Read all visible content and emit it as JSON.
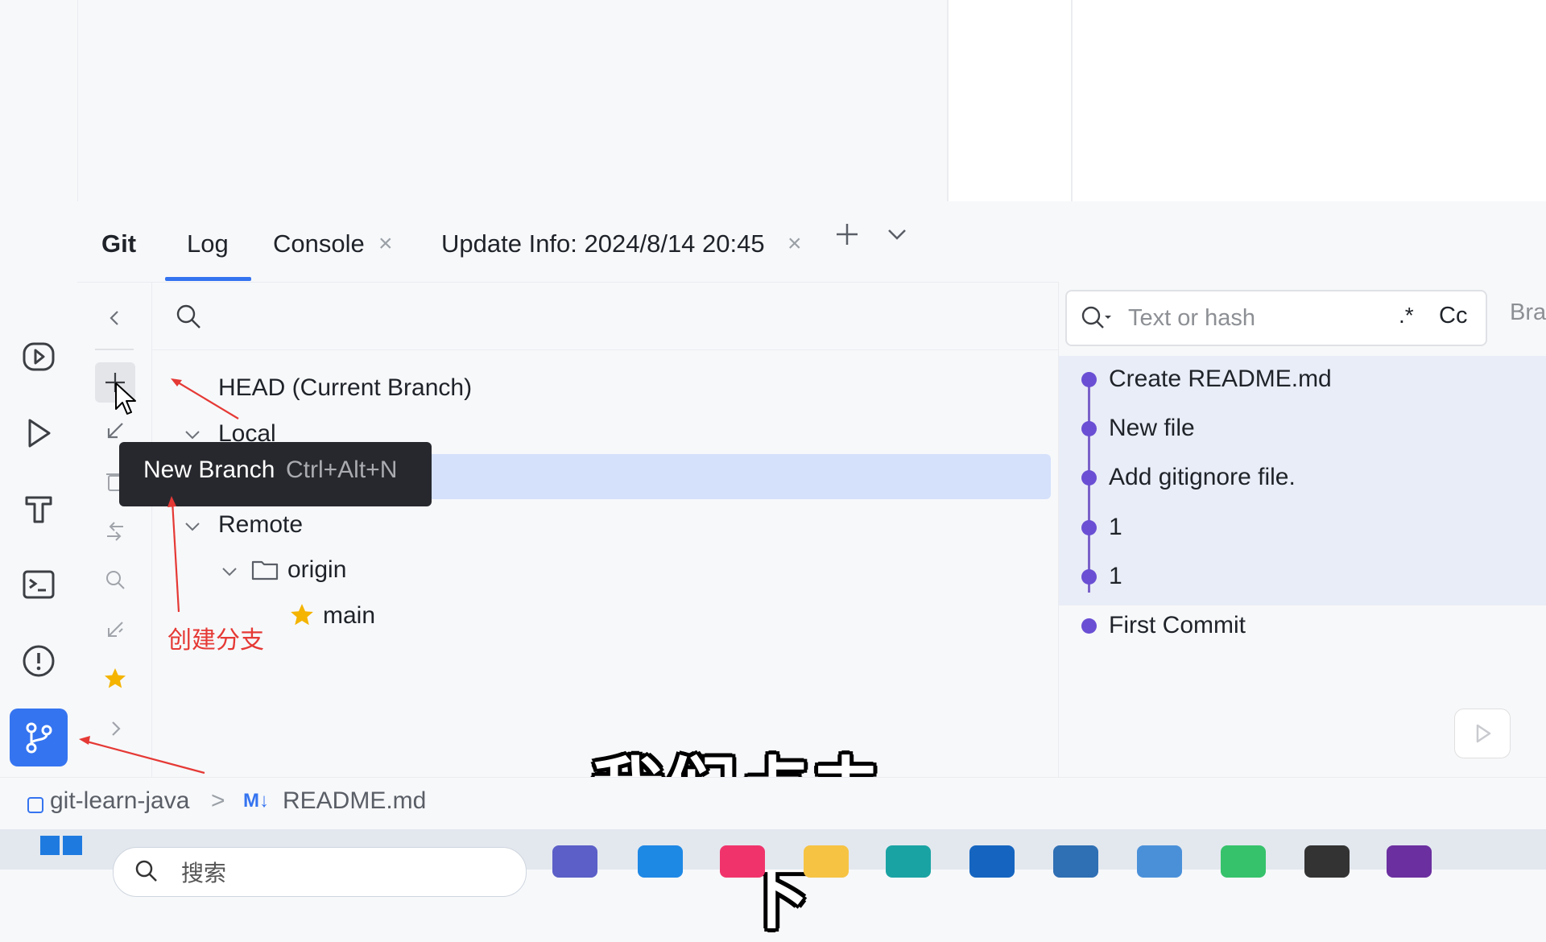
{
  "tool_window": {
    "title": "Git",
    "tabs": [
      {
        "label": "Log",
        "active": true
      },
      {
        "label": "Console",
        "closable": true
      },
      {
        "label": "Update Info: 2024/8/14 20:45",
        "closable": true
      }
    ],
    "close_glyph": "×"
  },
  "branches": {
    "head": "HEAD (Current Branch)",
    "local_label": "Local",
    "remote_label": "Remote",
    "remote_name": "origin",
    "remote_branch": "main"
  },
  "tooltip": {
    "label": "New Branch",
    "shortcut": "Ctrl+Alt+N"
  },
  "annotation": {
    "text": "创建分支",
    "color": "#e53935"
  },
  "log": {
    "search_placeholder": "Text or hash",
    "regex_label": ".*",
    "case_label": "Cc",
    "branch_filter": "Bra",
    "commits": [
      "Create README.md",
      "New file",
      "Add gitignore file.",
      "1",
      "1",
      "First Commit"
    ]
  },
  "subtitle": "我们点击一下",
  "status_bar": {
    "project": "git-learn-java",
    "separator": ">",
    "file_icon": "M↓",
    "file": "README.md"
  },
  "taskbar": {
    "search_text": "搜索"
  },
  "colors": {
    "accent": "#3574f0",
    "selection": "#d5e1fb",
    "commit_dot": "#6a4fd4",
    "star": "#f4b400"
  },
  "icons": [
    "run-widget-icon",
    "run-icon",
    "build-icon",
    "terminal-icon",
    "problems-icon",
    "git-branch-icon",
    "collapse-icon",
    "new-branch-icon",
    "checkout-icon",
    "delete-icon",
    "compare-icon",
    "search-icon",
    "update-icon",
    "star-icon",
    "expand-icon",
    "folder-icon"
  ]
}
